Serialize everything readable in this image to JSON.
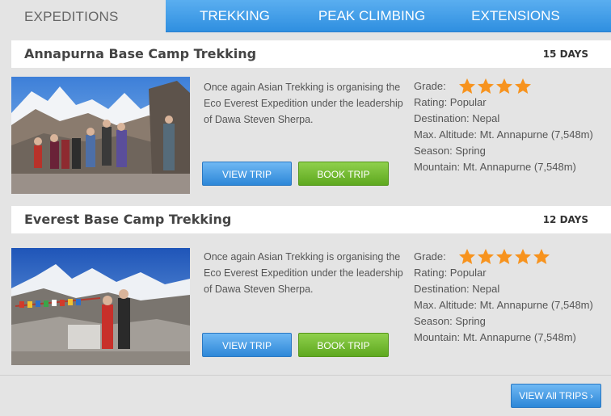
{
  "tabs": {
    "active": "EXPEDITIONS",
    "items": [
      "TREKKING",
      "PEAK CLIMBING",
      "EXTENSIONS"
    ]
  },
  "trips": [
    {
      "title": "Annapurna Base Camp Trekking",
      "days": "15 DAYS",
      "description": "Once again Asian Trekking is organising the Eco Everest Expedition under the leadership of Dawa Steven Sherpa.",
      "view_label": "VIEW TRIP",
      "book_label": "BOOK TRIP",
      "grade_label": "Grade:",
      "grade_stars": 4,
      "rating": "Rating: Popular",
      "destination": "Destination: Nepal",
      "altitude": "Max. Altitude: Mt. Annapurne (7,548m)",
      "season": "Season: Spring",
      "mountain": "Mountain: Mt. Annapurne (7,548m)"
    },
    {
      "title": "Everest Base Camp Trekking",
      "days": "12 DAYS",
      "description": "Once again Asian Trekking is organising the Eco Everest Expedition under the leadership of Dawa Steven Sherpa.",
      "view_label": "VIEW TRIP",
      "book_label": "BOOK TRIP",
      "grade_label": "Grade:",
      "grade_stars": 5,
      "rating": "Rating: Popular",
      "destination": "Destination: Nepal",
      "altitude": "Max. Altitude: Mt. Annapurne (7,548m)",
      "season": "Season: Spring",
      "mountain": "Mountain: Mt. Annapurne (7,548m)"
    }
  ],
  "footer": {
    "view_all_label": "VIEW All TRIPS",
    "chevron": "›"
  },
  "colors": {
    "tab_blue": "#3a97e6",
    "view_blue": "#4a9fe6",
    "book_green": "#74bd32",
    "star_orange": "#f7931e"
  }
}
